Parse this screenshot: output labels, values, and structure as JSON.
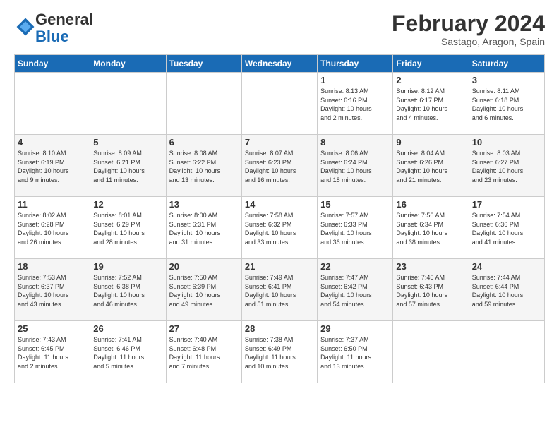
{
  "logo": {
    "line1": "General",
    "line2": "Blue"
  },
  "title": "February 2024",
  "location": "Sastago, Aragon, Spain",
  "days_of_week": [
    "Sunday",
    "Monday",
    "Tuesday",
    "Wednesday",
    "Thursday",
    "Friday",
    "Saturday"
  ],
  "weeks": [
    [
      {
        "day": "",
        "info": ""
      },
      {
        "day": "",
        "info": ""
      },
      {
        "day": "",
        "info": ""
      },
      {
        "day": "",
        "info": ""
      },
      {
        "day": "1",
        "info": "Sunrise: 8:13 AM\nSunset: 6:16 PM\nDaylight: 10 hours\nand 2 minutes."
      },
      {
        "day": "2",
        "info": "Sunrise: 8:12 AM\nSunset: 6:17 PM\nDaylight: 10 hours\nand 4 minutes."
      },
      {
        "day": "3",
        "info": "Sunrise: 8:11 AM\nSunset: 6:18 PM\nDaylight: 10 hours\nand 6 minutes."
      }
    ],
    [
      {
        "day": "4",
        "info": "Sunrise: 8:10 AM\nSunset: 6:19 PM\nDaylight: 10 hours\nand 9 minutes."
      },
      {
        "day": "5",
        "info": "Sunrise: 8:09 AM\nSunset: 6:21 PM\nDaylight: 10 hours\nand 11 minutes."
      },
      {
        "day": "6",
        "info": "Sunrise: 8:08 AM\nSunset: 6:22 PM\nDaylight: 10 hours\nand 13 minutes."
      },
      {
        "day": "7",
        "info": "Sunrise: 8:07 AM\nSunset: 6:23 PM\nDaylight: 10 hours\nand 16 minutes."
      },
      {
        "day": "8",
        "info": "Sunrise: 8:06 AM\nSunset: 6:24 PM\nDaylight: 10 hours\nand 18 minutes."
      },
      {
        "day": "9",
        "info": "Sunrise: 8:04 AM\nSunset: 6:26 PM\nDaylight: 10 hours\nand 21 minutes."
      },
      {
        "day": "10",
        "info": "Sunrise: 8:03 AM\nSunset: 6:27 PM\nDaylight: 10 hours\nand 23 minutes."
      }
    ],
    [
      {
        "day": "11",
        "info": "Sunrise: 8:02 AM\nSunset: 6:28 PM\nDaylight: 10 hours\nand 26 minutes."
      },
      {
        "day": "12",
        "info": "Sunrise: 8:01 AM\nSunset: 6:29 PM\nDaylight: 10 hours\nand 28 minutes."
      },
      {
        "day": "13",
        "info": "Sunrise: 8:00 AM\nSunset: 6:31 PM\nDaylight: 10 hours\nand 31 minutes."
      },
      {
        "day": "14",
        "info": "Sunrise: 7:58 AM\nSunset: 6:32 PM\nDaylight: 10 hours\nand 33 minutes."
      },
      {
        "day": "15",
        "info": "Sunrise: 7:57 AM\nSunset: 6:33 PM\nDaylight: 10 hours\nand 36 minutes."
      },
      {
        "day": "16",
        "info": "Sunrise: 7:56 AM\nSunset: 6:34 PM\nDaylight: 10 hours\nand 38 minutes."
      },
      {
        "day": "17",
        "info": "Sunrise: 7:54 AM\nSunset: 6:36 PM\nDaylight: 10 hours\nand 41 minutes."
      }
    ],
    [
      {
        "day": "18",
        "info": "Sunrise: 7:53 AM\nSunset: 6:37 PM\nDaylight: 10 hours\nand 43 minutes."
      },
      {
        "day": "19",
        "info": "Sunrise: 7:52 AM\nSunset: 6:38 PM\nDaylight: 10 hours\nand 46 minutes."
      },
      {
        "day": "20",
        "info": "Sunrise: 7:50 AM\nSunset: 6:39 PM\nDaylight: 10 hours\nand 49 minutes."
      },
      {
        "day": "21",
        "info": "Sunrise: 7:49 AM\nSunset: 6:41 PM\nDaylight: 10 hours\nand 51 minutes."
      },
      {
        "day": "22",
        "info": "Sunrise: 7:47 AM\nSunset: 6:42 PM\nDaylight: 10 hours\nand 54 minutes."
      },
      {
        "day": "23",
        "info": "Sunrise: 7:46 AM\nSunset: 6:43 PM\nDaylight: 10 hours\nand 57 minutes."
      },
      {
        "day": "24",
        "info": "Sunrise: 7:44 AM\nSunset: 6:44 PM\nDaylight: 10 hours\nand 59 minutes."
      }
    ],
    [
      {
        "day": "25",
        "info": "Sunrise: 7:43 AM\nSunset: 6:45 PM\nDaylight: 11 hours\nand 2 minutes."
      },
      {
        "day": "26",
        "info": "Sunrise: 7:41 AM\nSunset: 6:46 PM\nDaylight: 11 hours\nand 5 minutes."
      },
      {
        "day": "27",
        "info": "Sunrise: 7:40 AM\nSunset: 6:48 PM\nDaylight: 11 hours\nand 7 minutes."
      },
      {
        "day": "28",
        "info": "Sunrise: 7:38 AM\nSunset: 6:49 PM\nDaylight: 11 hours\nand 10 minutes."
      },
      {
        "day": "29",
        "info": "Sunrise: 7:37 AM\nSunset: 6:50 PM\nDaylight: 11 hours\nand 13 minutes."
      },
      {
        "day": "",
        "info": ""
      },
      {
        "day": "",
        "info": ""
      }
    ]
  ]
}
